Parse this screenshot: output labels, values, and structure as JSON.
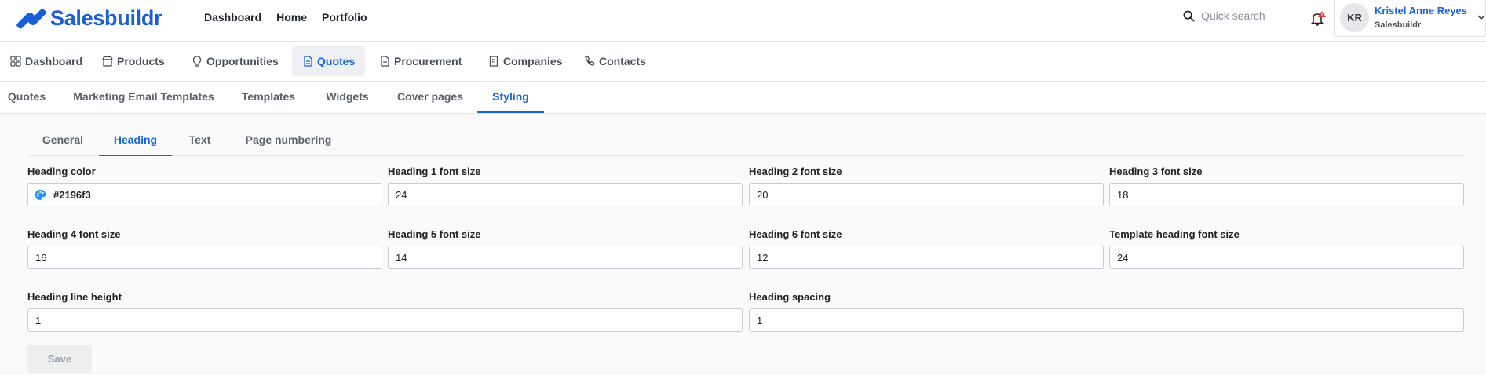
{
  "app": {
    "name": "Salesbuildr",
    "brand_color": "#1a5fd8",
    "accent_color": "#1a66d2"
  },
  "topnav": [
    "Dashboard",
    "Home",
    "Portfolio"
  ],
  "search": {
    "placeholder": "Quick search",
    "icon": "search-icon"
  },
  "notifications": {
    "icon": "bell-icon",
    "badge": "!"
  },
  "user": {
    "initials": "KR",
    "name": "Kristel Anne Reyes",
    "company": "Salesbuildr"
  },
  "modules": [
    {
      "label": "Dashboard",
      "icon": "grid-icon"
    },
    {
      "label": "Products",
      "icon": "store-icon"
    },
    {
      "label": "Opportunities",
      "icon": "lightbulb-icon"
    },
    {
      "label": "Quotes",
      "icon": "document-icon",
      "active": true
    },
    {
      "label": "Procurement",
      "icon": "file-icon"
    },
    {
      "label": "Companies",
      "icon": "building-icon"
    },
    {
      "label": "Contacts",
      "icon": "phone-icon"
    }
  ],
  "subtabs": [
    "Quotes",
    "Marketing Email Templates",
    "Templates",
    "Widgets",
    "Cover pages",
    "Styling"
  ],
  "active_subtab": "Styling",
  "styling_tabs": [
    "General",
    "Heading",
    "Text",
    "Page numbering"
  ],
  "active_styling_tab": "Heading",
  "fields": {
    "heading_color": {
      "label": "Heading color",
      "value": "#2196f3",
      "swatch": "#2196f3"
    },
    "h1": {
      "label": "Heading 1 font size",
      "value": "24"
    },
    "h2": {
      "label": "Heading 2 font size",
      "value": "20"
    },
    "h3": {
      "label": "Heading 3 font size",
      "value": "18"
    },
    "h4": {
      "label": "Heading 4 font size",
      "value": "16"
    },
    "h5": {
      "label": "Heading 5 font size",
      "value": "14"
    },
    "h6": {
      "label": "Heading 6 font size",
      "value": "12"
    },
    "template": {
      "label": "Template heading font size",
      "value": "24"
    },
    "line_height": {
      "label": "Heading line height",
      "value": "1"
    },
    "spacing": {
      "label": "Heading spacing",
      "value": "1"
    }
  },
  "save_label": "Save"
}
